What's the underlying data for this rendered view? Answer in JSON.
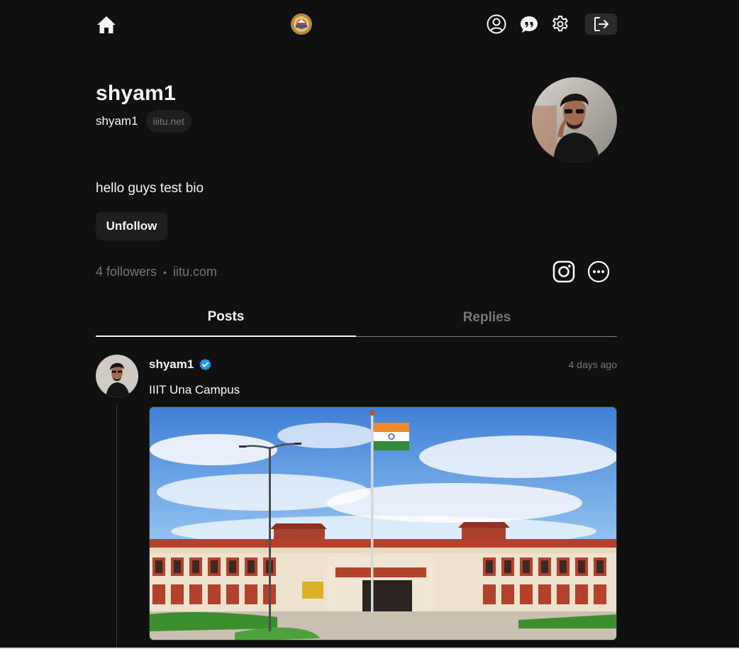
{
  "nav": {
    "home_icon": "home-icon",
    "logo_icon": "institute-logo",
    "user_icon": "user-circle-icon",
    "chat_icon": "chat-quote-icon",
    "settings_icon": "gear-icon",
    "logout_icon": "logout-icon"
  },
  "profile": {
    "name": "shyam1",
    "username": "shyam1",
    "domain_badge": "iiitu.net",
    "bio": "hello guys test bio",
    "follow_button": "Unfollow",
    "followers": "4 followers",
    "separator": "•",
    "link": "iitu.com"
  },
  "tabs": [
    {
      "label": "Posts",
      "active": true
    },
    {
      "label": "Replies",
      "active": false
    }
  ],
  "post": {
    "author": "shyam1",
    "verified": true,
    "time": "4 days ago",
    "text": "IIIT Una Campus"
  },
  "colors": {
    "background": "#101010",
    "text": "#f3f5f7",
    "muted": "#777777",
    "verified": "#1d9bf0"
  }
}
